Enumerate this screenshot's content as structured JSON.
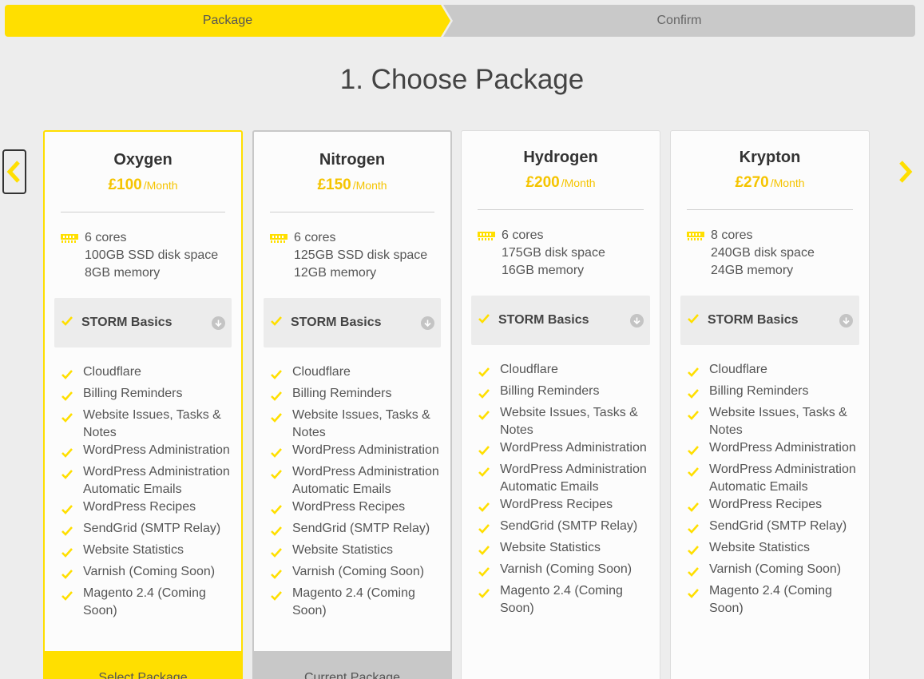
{
  "stepper": {
    "steps": [
      {
        "label": "Package",
        "active": true
      },
      {
        "label": "Confirm",
        "active": false
      }
    ]
  },
  "page_title": "1. Choose Package",
  "colors": {
    "accent": "#ffdf00",
    "price": "#f5c400",
    "inactive": "#c8c8c8",
    "background": "#ededed"
  },
  "carousel": {
    "prev_icon": "chevron-left-icon",
    "next_icon": "chevron-right-icon"
  },
  "packages": [
    {
      "name": "Oxygen",
      "price": "£100",
      "period": "/Month",
      "specs": [
        "6 cores",
        "100GB SSD disk space",
        "8GB memory"
      ],
      "basics_label": "STORM Basics",
      "features": [
        "Cloudflare",
        "Billing Reminders",
        "Website Issues, Tasks & Notes",
        "WordPress Administration",
        "WordPress Administration Automatic Emails",
        "WordPress Recipes",
        "SendGrid (SMTP Relay)",
        "Website Statistics",
        "Varnish (Coming Soon)",
        "Magento 2.4 (Coming Soon)"
      ],
      "button": "Select Package",
      "state": "selected"
    },
    {
      "name": "Nitrogen",
      "price": "£150",
      "period": "/Month",
      "specs": [
        "6 cores",
        "125GB SSD disk space",
        "12GB memory"
      ],
      "basics_label": "STORM Basics",
      "features": [
        "Cloudflare",
        "Billing Reminders",
        "Website Issues, Tasks & Notes",
        "WordPress Administration",
        "WordPress Administration Automatic Emails",
        "WordPress Recipes",
        "SendGrid (SMTP Relay)",
        "Website Statistics",
        "Varnish (Coming Soon)",
        "Magento 2.4 (Coming Soon)"
      ],
      "button": "Current Package",
      "state": "current"
    },
    {
      "name": "Hydrogen",
      "price": "£200",
      "period": "/Month",
      "specs": [
        "6 cores",
        "175GB disk space",
        "16GB memory"
      ],
      "basics_label": "STORM Basics",
      "features": [
        "Cloudflare",
        "Billing Reminders",
        "Website Issues, Tasks & Notes",
        "WordPress Administration",
        "WordPress Administration Automatic Emails",
        "WordPress Recipes",
        "SendGrid (SMTP Relay)",
        "Website Statistics",
        "Varnish (Coming Soon)",
        "Magento 2.4 (Coming Soon)"
      ],
      "button": "",
      "state": "default"
    },
    {
      "name": "Krypton",
      "price": "£270",
      "period": "/Month",
      "specs": [
        "8 cores",
        "240GB disk space",
        "24GB memory"
      ],
      "basics_label": "STORM Basics",
      "features": [
        "Cloudflare",
        "Billing Reminders",
        "Website Issues, Tasks & Notes",
        "WordPress Administration",
        "WordPress Administration Automatic Emails",
        "WordPress Recipes",
        "SendGrid (SMTP Relay)",
        "Website Statistics",
        "Varnish (Coming Soon)",
        "Magento 2.4 (Coming Soon)"
      ],
      "button": "",
      "state": "default"
    }
  ]
}
